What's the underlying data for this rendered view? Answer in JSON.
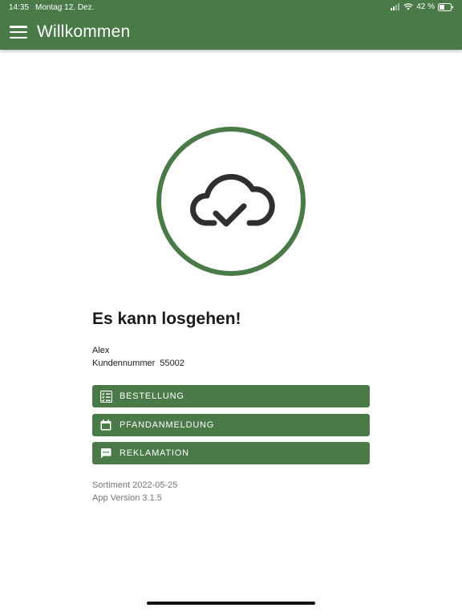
{
  "status_bar": {
    "time": "14:35",
    "date": "Montag 12. Dez.",
    "battery": "42 %",
    "icons": [
      "signal-icon",
      "wifi-icon",
      "battery-icon"
    ]
  },
  "app_bar": {
    "title": "Willkommen",
    "menu_icon": "hamburger-menu-icon"
  },
  "hero": {
    "icon": "cloud-check-icon",
    "ring_color": "#4a7a48"
  },
  "main": {
    "heading": "Es kann losgehen!",
    "user_name": "Alex",
    "customer_label": "Kundennummer",
    "customer_number": "55002"
  },
  "actions": [
    {
      "label": "BESTELLUNG",
      "icon": "checklist-icon"
    },
    {
      "label": "PFANDANMELDUNG",
      "icon": "calendar-icon"
    },
    {
      "label": "REKLAMATION",
      "icon": "comment-icon"
    }
  ],
  "footer": {
    "sortiment": "Sortiment 2022-05-25",
    "app_version": "App Version 3.1.5"
  },
  "colors": {
    "primary": "#4a7a48",
    "text": "#1a1a1a",
    "muted": "#777777"
  }
}
